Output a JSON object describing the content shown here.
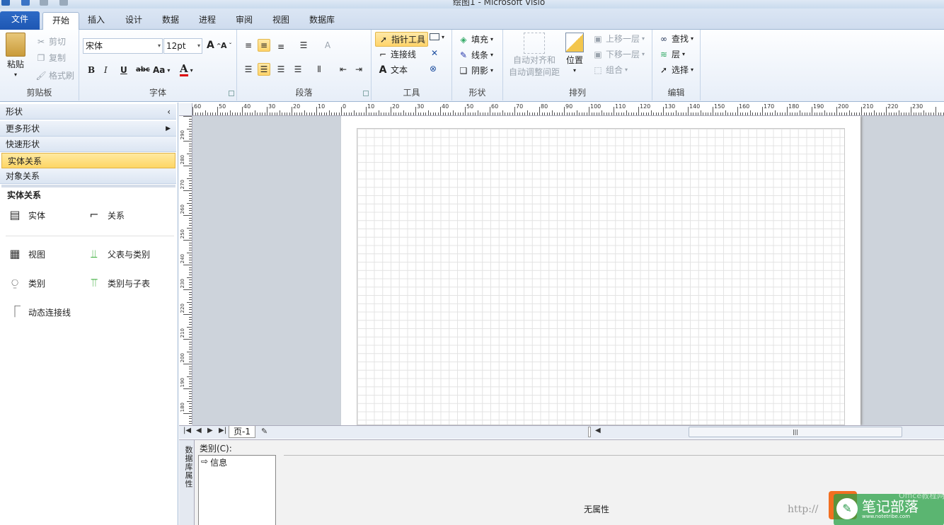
{
  "window": {
    "title": "绘图1 - Microsoft Visio"
  },
  "tabs": {
    "file": "文件",
    "home": "开始",
    "insert": "插入",
    "design": "设计",
    "data": "数据",
    "process": "进程",
    "review": "审阅",
    "view": "视图",
    "database": "数据库"
  },
  "clipboard": {
    "paste": "粘贴",
    "cut": "剪切",
    "copy": "复制",
    "format_painter": "格式刷",
    "label": "剪贴板"
  },
  "font": {
    "name": "宋体",
    "size": "12pt",
    "bold": "B",
    "italic": "I",
    "underline": "U",
    "strike": "abc",
    "case": "Aa",
    "color": "A",
    "label": "字体"
  },
  "paragraph": {
    "label": "段落"
  },
  "tools": {
    "pointer": "指针工具",
    "connector": "连接线",
    "text": "文本",
    "label": "工具"
  },
  "shape": {
    "fill": "填充",
    "line": "线条",
    "shadow": "阴影",
    "label": "形状"
  },
  "arrange": {
    "auto_align_1": "自动对齐和",
    "auto_align_2": "自动调整间距",
    "position": "位置",
    "bring_forward": "上移一层",
    "send_backward": "下移一层",
    "group": "组合",
    "label": "排列"
  },
  "editing": {
    "find": "查找",
    "layer": "层",
    "select": "选择",
    "label": "编辑"
  },
  "shapes_pane": {
    "title": "形状",
    "more_shapes": "更多形状",
    "quick_shapes": "快速形状",
    "entity_relationship": "实体关系",
    "object_relationship": "对象关系",
    "stencil_title": "实体关系",
    "items": [
      "实体",
      "关系",
      "视图",
      "父表与类别",
      "类别",
      "类别与子表",
      "动态连接线"
    ]
  },
  "rulers": {
    "h_ticks": [
      "60",
      "50",
      "40",
      "30",
      "20",
      "10",
      "0",
      "10",
      "20",
      "30",
      "40",
      "50",
      "60",
      "70",
      "80",
      "90",
      "100",
      "110",
      "120",
      "130",
      "140",
      "150",
      "160",
      "170",
      "180",
      "190",
      "200",
      "210",
      "220",
      "230"
    ],
    "v_ticks": [
      "290",
      "280",
      "270",
      "260",
      "250",
      "240",
      "230",
      "220",
      "210",
      "200",
      "190",
      "180"
    ]
  },
  "page_tabs": {
    "page1": "页-1"
  },
  "db_properties": {
    "panel_title": "数据库属性",
    "category_label": "类别(C):",
    "category_item": "信息",
    "empty_text": "无属性"
  },
  "watermark": {
    "url": "http://",
    "brand": "笔记部落",
    "brand_url": "www.notetribe.com",
    "office": "Office教程网"
  },
  "colors": {
    "file_tab": "#2060b8",
    "selected": "#ffd66a",
    "canvas_bg": "#cdd3db"
  }
}
